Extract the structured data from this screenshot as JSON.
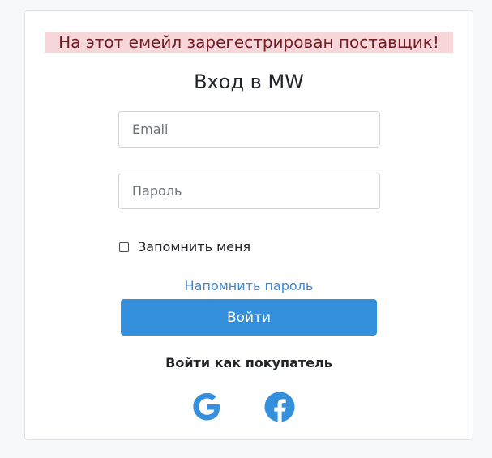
{
  "alert": {
    "message": "На этот емейл зарегестрирован поставщик!"
  },
  "form": {
    "title": "Вход в MW",
    "email_placeholder": "Email",
    "password_placeholder": "Пароль",
    "remember_label": "Запомнить меня",
    "remember_checked": false,
    "forgot_link": "Напомнить пароль",
    "submit_label": "Войти"
  },
  "social": {
    "heading": "Войти как покупатель",
    "providers": [
      {
        "name": "google-icon"
      },
      {
        "name": "facebook-icon"
      }
    ]
  },
  "colors": {
    "accent": "#3490dc",
    "alert_bg": "#f8d7da",
    "alert_text": "#721c24",
    "link": "#3d86d4"
  }
}
